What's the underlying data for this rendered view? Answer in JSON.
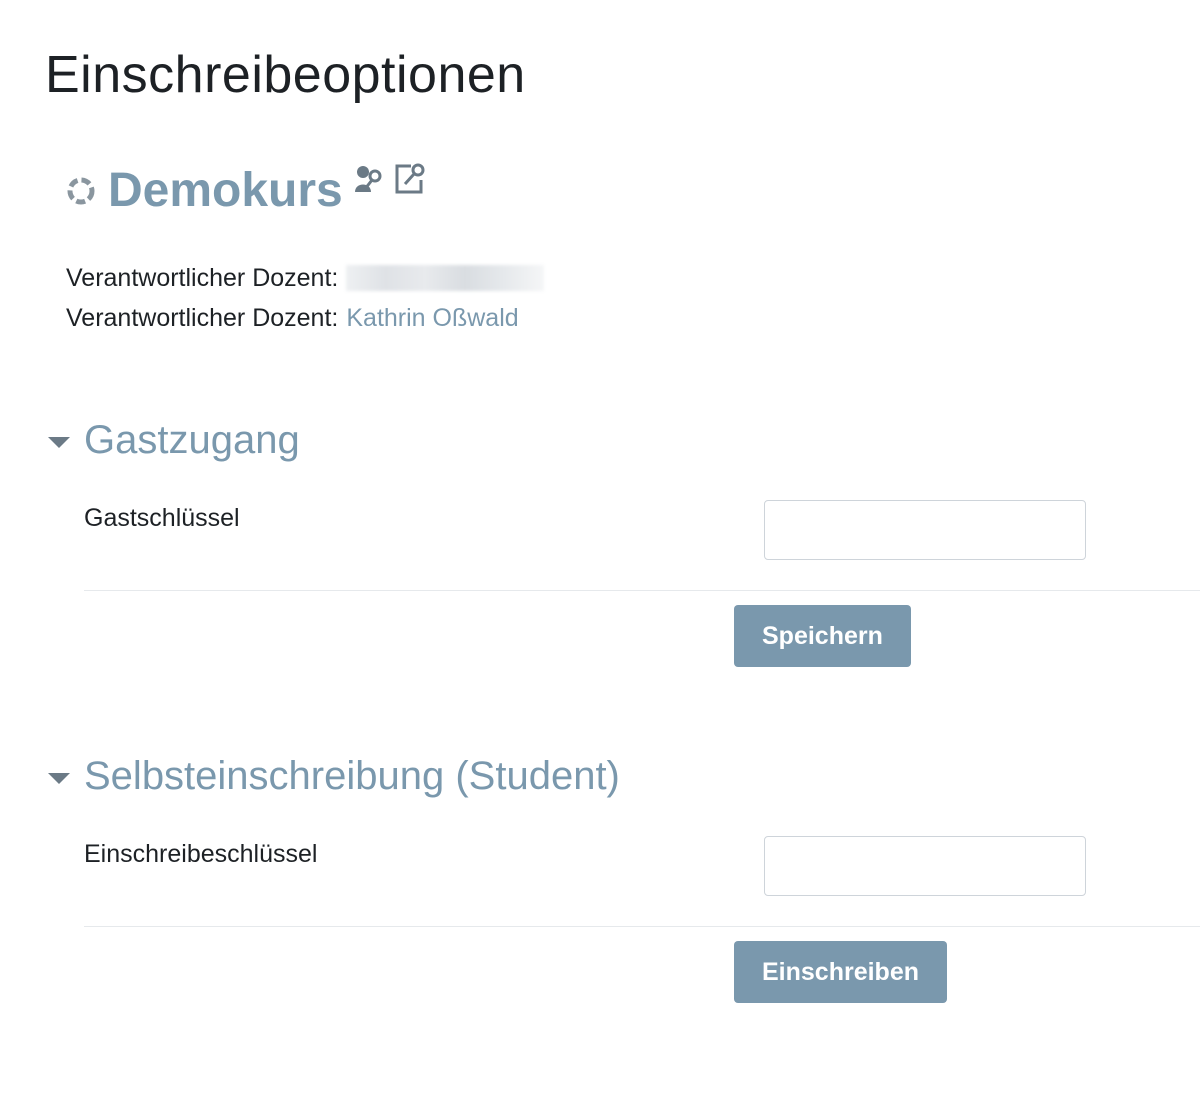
{
  "page": {
    "title": "Einschreibeoptionen"
  },
  "course": {
    "name": "Demokurs",
    "icons": [
      "course-icon",
      "guest-key-icon",
      "self-enrol-key-icon"
    ],
    "teachers": [
      {
        "label": "Verantwortlicher Dozent:",
        "name": ""
      },
      {
        "label": "Verantwortlicher Dozent:",
        "name": "Kathrin Oßwald"
      }
    ]
  },
  "sections": [
    {
      "title": "Gastzugang",
      "field_label": "Gastschlüssel",
      "field_value": "",
      "button_label": "Speichern"
    },
    {
      "title": "Selbsteinschreibung (Student)",
      "field_label": "Einschreibeschlüssel",
      "field_value": "",
      "button_label": "Einschreiben"
    }
  ],
  "colors": {
    "accent": "#7a98ad",
    "text": "#1d2125",
    "button_bg": "#7a98ad",
    "button_text": "#ffffff",
    "input_border": "#ced4da"
  }
}
